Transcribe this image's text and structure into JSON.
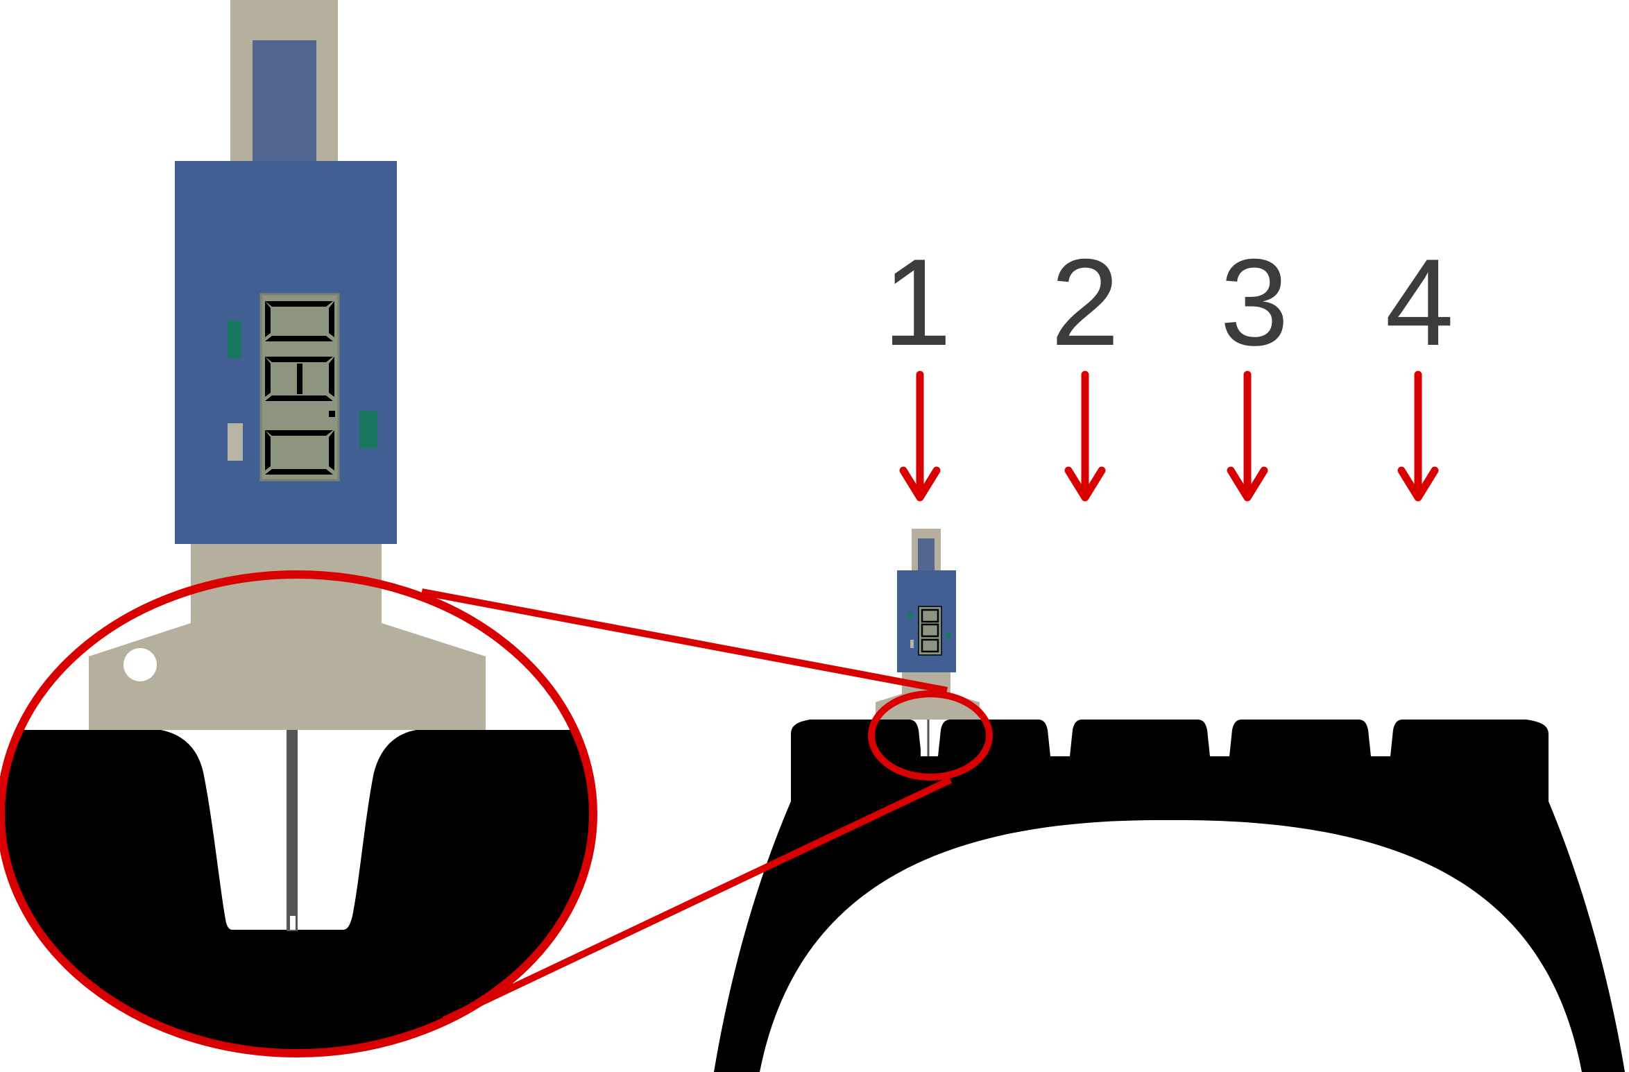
{
  "figure": {
    "position_labels": [
      "1",
      "2",
      "3",
      "4"
    ]
  },
  "colors": {
    "gauge_body": "#415f93",
    "gauge_frame": "#b5b09d",
    "lcd_background": "#8c9580",
    "lcd_digit": "#000000",
    "indicator_green": "#19775f",
    "indicator_grey": "#b7b4a6",
    "tire": "#000000",
    "arrow_and_magnifier": "#d80000",
    "position_number": "#3c3c3c",
    "probe": "#555555"
  },
  "icons": {
    "arrow": "down-arrow-icon",
    "gauge": "tread-depth-gauge-icon",
    "magnifier": "magnifier-loupe-icon"
  }
}
